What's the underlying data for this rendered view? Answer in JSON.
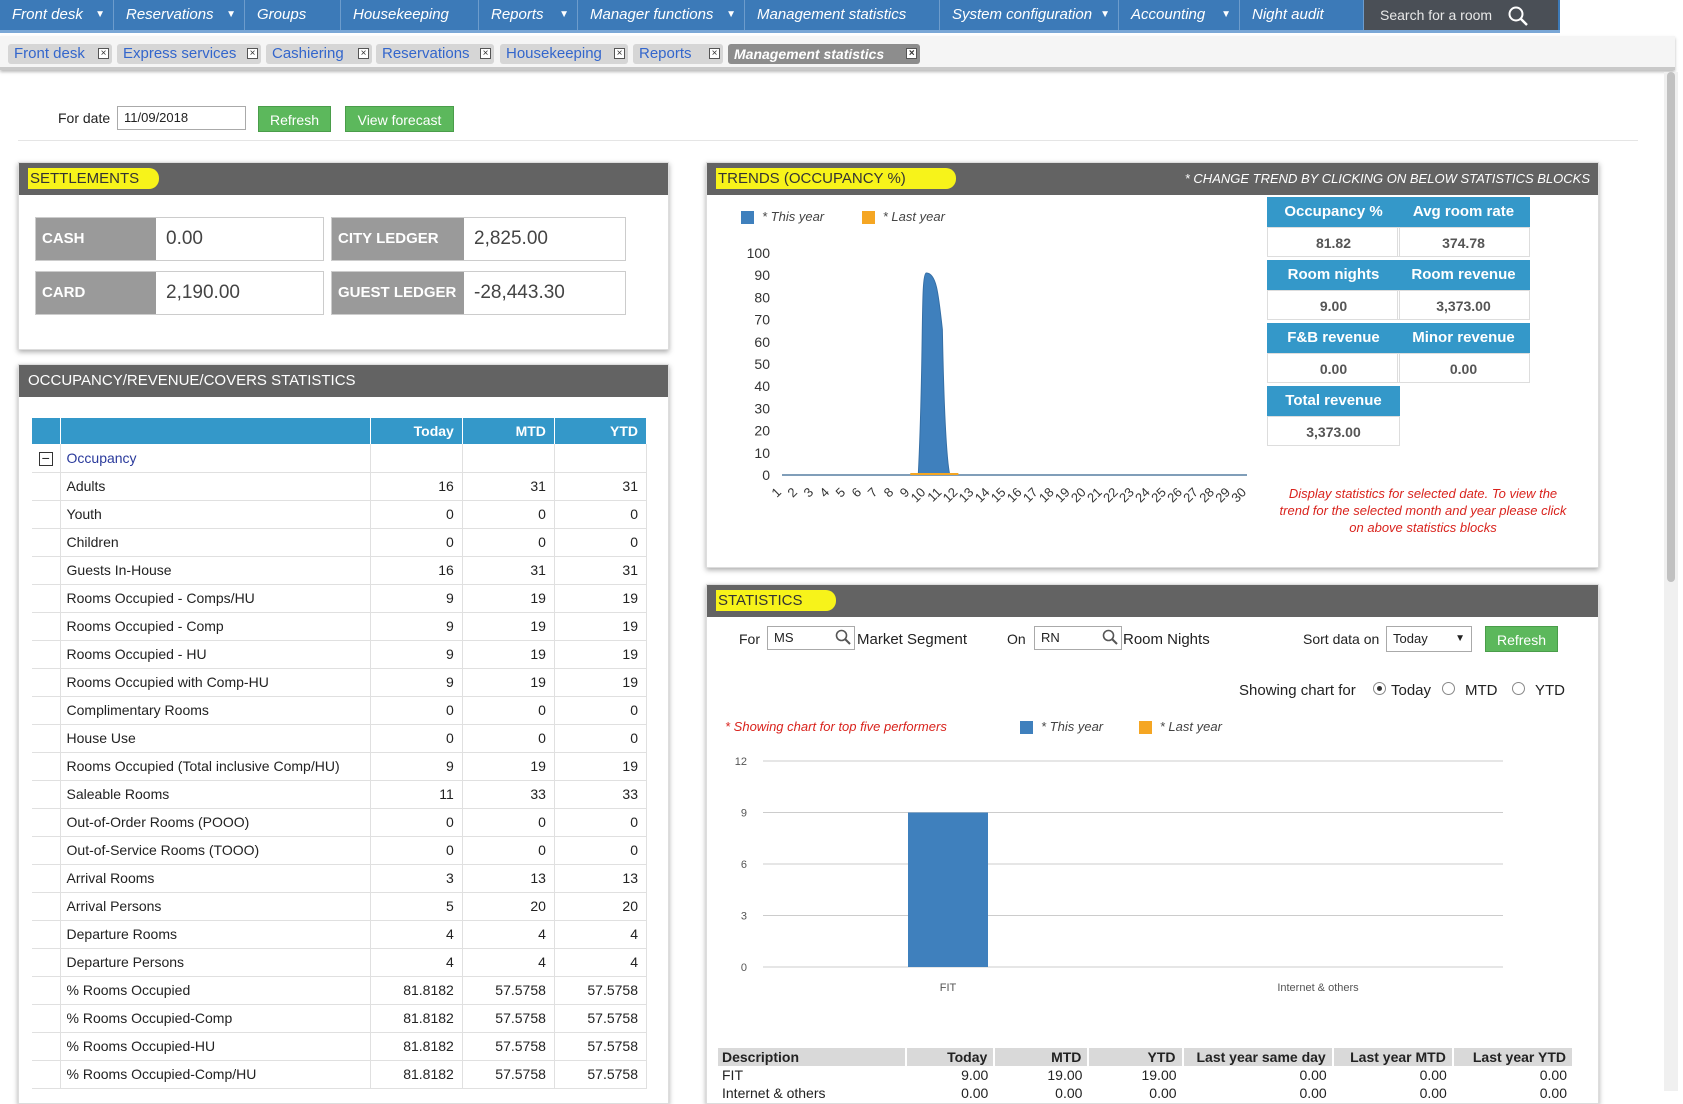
{
  "nav": [
    {
      "label": "Front desk",
      "caret": true,
      "w": 114
    },
    {
      "label": "Reservations",
      "caret": true,
      "w": 131
    },
    {
      "label": "Groups",
      "caret": false,
      "w": 96
    },
    {
      "label": "Housekeeping",
      "caret": false,
      "w": 138
    },
    {
      "label": "Reports",
      "caret": true,
      "w": 99
    },
    {
      "label": "Manager functions",
      "caret": true,
      "w": 167
    },
    {
      "label": "Management statistics",
      "caret": false,
      "w": 195
    },
    {
      "label": "System configuration",
      "caret": true,
      "w": 179
    },
    {
      "label": "Accounting",
      "caret": true,
      "w": 121
    },
    {
      "label": "Night audit",
      "caret": false,
      "w": 124
    }
  ],
  "search_label": "Search for a room",
  "tabs": [
    {
      "label": "Front desk",
      "x": 8,
      "w": 104
    },
    {
      "label": "Express services",
      "x": 117,
      "w": 144
    },
    {
      "label": "Cashiering",
      "x": 266,
      "w": 106
    },
    {
      "label": "Reservations",
      "x": 376,
      "w": 118
    },
    {
      "label": "Housekeeping",
      "x": 500,
      "w": 128
    },
    {
      "label": "Reports",
      "x": 633,
      "w": 90
    },
    {
      "label": "Management statistics",
      "x": 728,
      "w": 192,
      "active": true
    }
  ],
  "date_bar": {
    "label": "For date",
    "value": "11/09/2018",
    "refresh": "Refresh",
    "forecast": "View forecast"
  },
  "settlements": {
    "title": "SETTLEMENTS",
    "items": [
      {
        "label": "CASH",
        "value": "0.00"
      },
      {
        "label": "CITY LEDGER",
        "value": "2,825.00"
      },
      {
        "label": "CARD",
        "value": "2,190.00"
      },
      {
        "label": "GUEST LEDGER",
        "value": "-28,443.30"
      }
    ]
  },
  "occ_panel": {
    "title": "OCCUPANCY/REVENUE/COVERS STATISTICS",
    "columns": [
      "Today",
      "MTD",
      "YTD"
    ],
    "group": "Occupancy",
    "rows": [
      [
        "Adults",
        "16",
        "31",
        "31"
      ],
      [
        "Youth",
        "0",
        "0",
        "0"
      ],
      [
        "Children",
        "0",
        "0",
        "0"
      ],
      [
        "Guests In-House",
        "16",
        "31",
        "31"
      ],
      [
        "Rooms Occupied - Comps/HU",
        "9",
        "19",
        "19"
      ],
      [
        "Rooms Occupied - Comp",
        "9",
        "19",
        "19"
      ],
      [
        "Rooms Occupied - HU",
        "9",
        "19",
        "19"
      ],
      [
        "Rooms Occupied with Comp-HU",
        "9",
        "19",
        "19"
      ],
      [
        "Complimentary Rooms",
        "0",
        "0",
        "0"
      ],
      [
        "House Use",
        "0",
        "0",
        "0"
      ],
      [
        "Rooms Occupied (Total inclusive Comp/HU)",
        "9",
        "19",
        "19"
      ],
      [
        "Saleable Rooms",
        "11",
        "33",
        "33"
      ],
      [
        "Out-of-Order Rooms (POOO)",
        "0",
        "0",
        "0"
      ],
      [
        "Out-of-Service Rooms (TOOO)",
        "0",
        "0",
        "0"
      ],
      [
        "Arrival Rooms",
        "3",
        "13",
        "13"
      ],
      [
        "Arrival Persons",
        "5",
        "20",
        "20"
      ],
      [
        "Departure Rooms",
        "4",
        "4",
        "4"
      ],
      [
        "Departure Persons",
        "4",
        "4",
        "4"
      ],
      [
        "% Rooms Occupied",
        "81.8182",
        "57.5758",
        "57.5758"
      ],
      [
        "% Rooms Occupied-Comp",
        "81.8182",
        "57.5758",
        "57.5758"
      ],
      [
        "% Rooms Occupied-HU",
        "81.8182",
        "57.5758",
        "57.5758"
      ],
      [
        "% Rooms Occupied-Comp/HU",
        "81.8182",
        "57.5758",
        "57.5758"
      ]
    ]
  },
  "trends": {
    "title": "TRENDS (OCCUPANCY %)",
    "note": "* CHANGE TREND BY CLICKING ON BELOW STATISTICS BLOCKS",
    "legend_this": "* This year",
    "legend_last": "* Last year",
    "blocks": [
      {
        "label": "Occupancy %",
        "value": "81.82"
      },
      {
        "label": "Avg room rate",
        "value": "374.78"
      },
      {
        "label": "Room nights",
        "value": "9.00"
      },
      {
        "label": "Room revenue",
        "value": "3,373.00"
      },
      {
        "label": "F&B revenue",
        "value": "0.00"
      },
      {
        "label": "Minor revenue",
        "value": "0.00"
      },
      {
        "label": "Total revenue",
        "value": "3,373.00"
      }
    ],
    "hint": "Display statistics for selected date. To view the trend for the selected month and year please click on above statistics blocks"
  },
  "statistics": {
    "title": "STATISTICS",
    "for_label": "For",
    "for_value": "MS",
    "for_desc": "Market Segment",
    "on_label": "On",
    "on_value": "RN",
    "on_desc": "Room Nights",
    "sort_label": "Sort data on",
    "sort_value": "Today",
    "refresh": "Refresh",
    "showing_label": "Showing chart for",
    "opt_today": "Today",
    "opt_mtd": "MTD",
    "opt_ytd": "YTD",
    "top_note": "* Showing chart for top five performers",
    "legend_this": "* This year",
    "legend_last": "* Last year",
    "table_head": [
      "Description",
      "Today",
      "MTD",
      "YTD",
      "Last year same day",
      "Last year MTD",
      "Last year YTD"
    ],
    "table_rows": [
      [
        "FIT",
        "9.00",
        "19.00",
        "19.00",
        "0.00",
        "0.00",
        "0.00"
      ],
      [
        "Internet & others",
        "0.00",
        "0.00",
        "0.00",
        "0.00",
        "0.00",
        "0.00"
      ]
    ]
  },
  "chart_data": [
    {
      "type": "area",
      "x": [
        1,
        2,
        3,
        4,
        5,
        6,
        7,
        8,
        9,
        10,
        11,
        12,
        13,
        14,
        15,
        16,
        17,
        18,
        19,
        20,
        21,
        22,
        23,
        24,
        25,
        26,
        27,
        28,
        29,
        30
      ],
      "series": [
        {
          "name": "* This year",
          "values": [
            0,
            0,
            0,
            0,
            0,
            0,
            0,
            0,
            0,
            91,
            82,
            0,
            0,
            0,
            0,
            0,
            0,
            0,
            0,
            0,
            0,
            0,
            0,
            0,
            0,
            0,
            0,
            0,
            0,
            0
          ]
        },
        {
          "name": "* Last year",
          "values": [
            0,
            0,
            0,
            0,
            0,
            0,
            0,
            0,
            0,
            0,
            0,
            0,
            0,
            0,
            0,
            0,
            0,
            0,
            0,
            0,
            0,
            0,
            0,
            0,
            0,
            0,
            0,
            0,
            0,
            0
          ]
        }
      ],
      "ylim": [
        0,
        100
      ],
      "yticks": [
        0,
        10,
        20,
        30,
        40,
        50,
        60,
        70,
        80,
        90,
        100
      ],
      "colors": {
        "this": "#3f80bd",
        "last": "#f5a623"
      }
    },
    {
      "type": "bar",
      "categories": [
        "FIT",
        "Internet & others"
      ],
      "series": [
        {
          "name": "* This year",
          "values": [
            9,
            0
          ]
        },
        {
          "name": "* Last year",
          "values": [
            0,
            0
          ]
        }
      ],
      "ylim": [
        0,
        12
      ],
      "yticks": [
        0,
        3,
        6,
        9,
        12
      ],
      "colors": {
        "this": "#3f80bd",
        "last": "#f5a623"
      }
    }
  ]
}
